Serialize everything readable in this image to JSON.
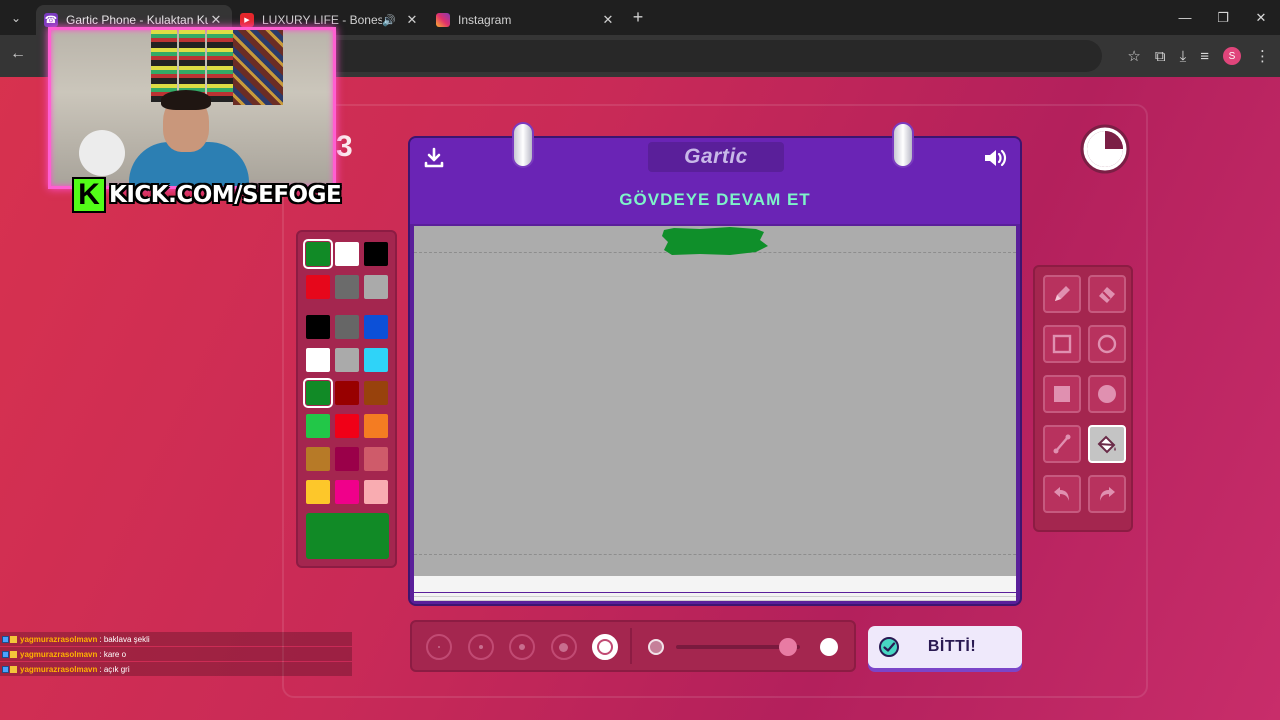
{
  "browser": {
    "tabs": [
      {
        "title": "Gartic Phone - Kulaktan Kulağa",
        "active": true,
        "favicon": "phone-icon"
      },
      {
        "title": "LUXURY LIFE - Bones & Edd",
        "active": false,
        "favicon": "youtube-icon",
        "audio": true
      },
      {
        "title": "Instagram",
        "active": false,
        "favicon": "instagram-icon"
      }
    ],
    "profile_initial": "S"
  },
  "stream": {
    "kick_logo": "K",
    "kick_url": "KICK.COM/SEFOGE"
  },
  "game": {
    "round_number": "3",
    "logo": "Gartic",
    "prompt": "GÖVDEYE DEVAM ET",
    "done_button": "BİTTİ!",
    "palette": {
      "selected_color": "#118a26",
      "top_colors": [
        "#118a26",
        "#ffffff",
        "#000000",
        "#e6071b",
        "#6b6b6b",
        "#aaaaaa"
      ],
      "colors": [
        "#000000",
        "#666666",
        "#0c50d8",
        "#ffffff",
        "#aaaaaa",
        "#2fd3f8",
        "#118a26",
        "#980000",
        "#98420c",
        "#22c748",
        "#f00017",
        "#f47c22",
        "#b77a27",
        "#9a0049",
        "#cf5b6a",
        "#fdc72a",
        "#f0008a",
        "#f9acb1"
      ]
    },
    "tools": [
      {
        "name": "pencil-tool",
        "icon": "pencil-icon",
        "selected": false
      },
      {
        "name": "eraser-tool",
        "icon": "eraser-icon",
        "selected": false
      },
      {
        "name": "rectangle-outline-tool",
        "icon": "square-outline-icon",
        "selected": false
      },
      {
        "name": "ellipse-outline-tool",
        "icon": "circle-outline-icon",
        "selected": false
      },
      {
        "name": "rectangle-fill-tool",
        "icon": "square-filled-icon",
        "selected": false
      },
      {
        "name": "ellipse-fill-tool",
        "icon": "circle-filled-icon",
        "selected": false
      },
      {
        "name": "line-tool",
        "icon": "line-icon",
        "selected": false
      },
      {
        "name": "fill-bucket-tool",
        "icon": "paint-bucket-icon",
        "selected": true
      },
      {
        "name": "undo-tool",
        "icon": "undo-icon",
        "selected": false
      },
      {
        "name": "redo-tool",
        "icon": "redo-icon",
        "selected": false
      }
    ],
    "brush_sizes": {
      "count": 5,
      "selected_index": 4
    },
    "opacity_level": 0.9
  },
  "chat": [
    {
      "user": "yagmurazrasolmavn",
      "message": ": baklava şekli"
    },
    {
      "user": "yagmurazrasolmavn",
      "message": ": kare o"
    },
    {
      "user": "yagmurazrasolmavn",
      "message": ": açık gri"
    }
  ]
}
